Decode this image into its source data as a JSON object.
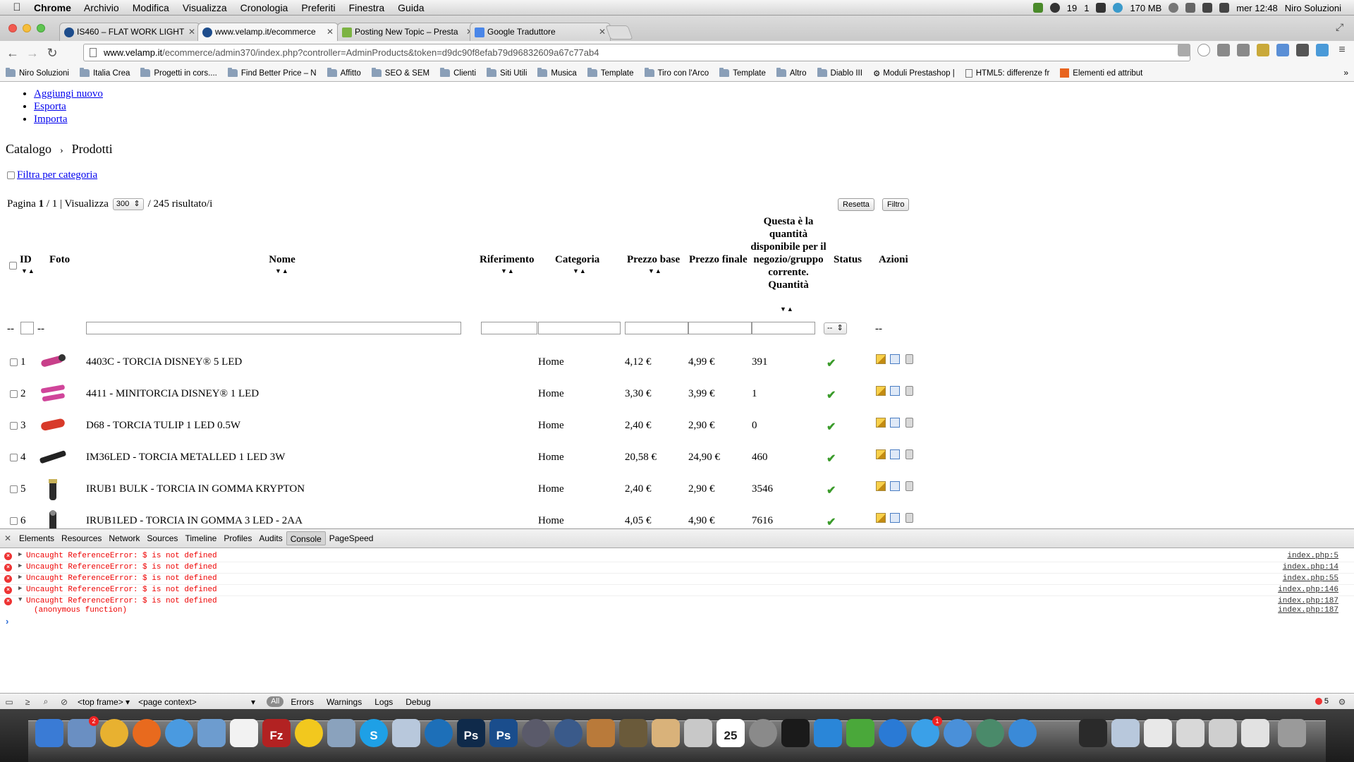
{
  "menubar": {
    "app_name": "Chrome",
    "menus": [
      "Archivio",
      "Modifica",
      "Visualizza",
      "Cronologia",
      "Preferiti",
      "Finestra",
      "Guida"
    ],
    "status_count_a": "19",
    "status_count_b": "1",
    "memory": "170 MB",
    "clock": "mer 12:48",
    "user": "Niro Soluzioni"
  },
  "tabs": [
    {
      "title": "IS460 – FLAT WORK LIGHT",
      "active": false
    },
    {
      "title": "www.velamp.it/ecommerce",
      "active": true
    },
    {
      "title": "Posting New Topic – Presta",
      "active": false
    },
    {
      "title": "Google Traduttore",
      "active": false
    }
  ],
  "address": {
    "host": "www.velamp.it",
    "path": "/ecommerce/admin370/index.php?controller=AdminProducts&token=d9dc90f8efab79d96832609a67c77ab4"
  },
  "bookmarks": [
    {
      "label": "Niro Soluzioni",
      "icon": "folder-icon"
    },
    {
      "label": "Italia Crea",
      "icon": "folder-icon"
    },
    {
      "label": "Progetti in cors....",
      "icon": "folder-icon"
    },
    {
      "label": "Find Better Price – N",
      "icon": "folder-icon"
    },
    {
      "label": "Affitto",
      "icon": "folder-icon"
    },
    {
      "label": "SEO & SEM",
      "icon": "folder-icon"
    },
    {
      "label": "Clienti",
      "icon": "folder-icon"
    },
    {
      "label": "Siti Utili",
      "icon": "folder-icon"
    },
    {
      "label": "Musica",
      "icon": "folder-icon"
    },
    {
      "label": "Template",
      "icon": "folder-icon"
    },
    {
      "label": "Tiro con l'Arco",
      "icon": "folder-icon"
    },
    {
      "label": "Template",
      "icon": "folder-icon"
    },
    {
      "label": "Altro",
      "icon": "folder-icon"
    },
    {
      "label": "Diablo III",
      "icon": "folder-icon"
    },
    {
      "label": "Moduli Prestashop |",
      "icon": "gear-icon"
    },
    {
      "label": "HTML5: differenze fr",
      "icon": "page-icon"
    },
    {
      "label": "Elementi ed attribut",
      "icon": "h-icon"
    }
  ],
  "page": {
    "menu": [
      "Aggiungi nuovo",
      "Esporta",
      "Importa"
    ],
    "breadcrumb": [
      "Catalogo",
      "Prodotti"
    ],
    "filter_category": "Filtra per categoria",
    "pager": {
      "label_page": "Pagina",
      "page": "1",
      "of": "/ 1 | Visualizza",
      "per_page": "300",
      "results": "/ 245 risultato/i"
    },
    "buttons": {
      "reset": "Resetta",
      "filter": "Filtro"
    },
    "columns": {
      "id": "ID",
      "photo": "Foto",
      "name": "Nome",
      "reference": "Riferimento",
      "category": "Categoria",
      "base_price": "Prezzo base",
      "final_price": "Prezzo finale",
      "quantity": "Questa è la quantità disponibile per il negozio/gruppo corrente. Quantità",
      "status": "Status",
      "actions": "Azioni"
    },
    "filter_row": {
      "dash": "--",
      "status_select": "--"
    },
    "rows": [
      {
        "id": "1",
        "name": "4403C - TORCIA DISNEY® 5 LED",
        "category": "Home",
        "base": "4,12 €",
        "final": "4,99 €",
        "qty": "391",
        "thumb": "#c8408a"
      },
      {
        "id": "2",
        "name": "4411 - MINITORCIA DISNEY® 1 LED",
        "category": "Home",
        "base": "3,30 €",
        "final": "3,99 €",
        "qty": "1",
        "thumb": "#d0459a"
      },
      {
        "id": "3",
        "name": "D68 - TORCIA TULIP 1 LED 0.5W",
        "category": "Home",
        "base": "2,40 €",
        "final": "2,90 €",
        "qty": "0",
        "thumb": "#d83a2a"
      },
      {
        "id": "4",
        "name": "IM36LED - TORCIA METALLED 1 LED 3W",
        "category": "Home",
        "base": "20,58 €",
        "final": "24,90 €",
        "qty": "460",
        "thumb": "#222222"
      },
      {
        "id": "5",
        "name": "IRUB1 BULK - TORCIA IN GOMMA KRYPTON",
        "category": "Home",
        "base": "2,40 €",
        "final": "2,90 €",
        "qty": "3546",
        "thumb": "#2b2b2b"
      },
      {
        "id": "6",
        "name": "IRUB1LED - TORCIA IN GOMMA 3 LED - 2AA",
        "category": "Home",
        "base": "4,05 €",
        "final": "4,90 €",
        "qty": "7616",
        "thumb": "#2b2b2b"
      }
    ]
  },
  "devtools": {
    "tabs": [
      "Elements",
      "Resources",
      "Network",
      "Sources",
      "Timeline",
      "Profiles",
      "Audits",
      "Console",
      "PageSpeed"
    ],
    "active_tab": "Console",
    "errors": [
      {
        "msg": "Uncaught ReferenceError: $ is not defined",
        "src": "index.php:5"
      },
      {
        "msg": "Uncaught ReferenceError: $ is not defined",
        "src": "index.php:14"
      },
      {
        "msg": "Uncaught ReferenceError: $ is not defined",
        "src": "index.php:55"
      },
      {
        "msg": "Uncaught ReferenceError: $ is not defined",
        "src": "index.php:146"
      },
      {
        "msg": "Uncaught ReferenceError: $ is not defined",
        "src": "index.php:187"
      }
    ],
    "error_sub": "(anonymous function)",
    "error_sub_src": "index.php:187",
    "status": {
      "frame": "<top frame>",
      "context": "<page context>",
      "filters": [
        "All",
        "Errors",
        "Warnings",
        "Logs",
        "Debug"
      ],
      "error_count": "5"
    }
  },
  "dock": {
    "calendar_day": "25",
    "mail_badge": "2",
    "appstore_badge": "1"
  }
}
